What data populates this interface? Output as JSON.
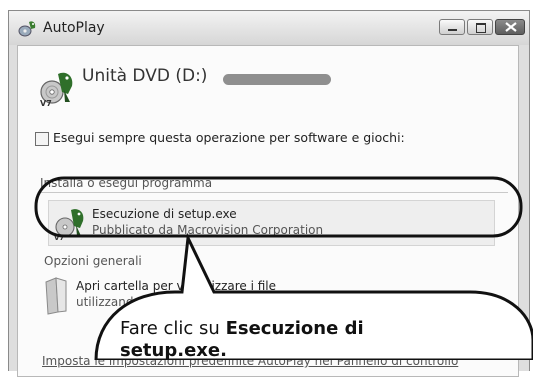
{
  "window": {
    "title": "AutoPlay"
  },
  "device": {
    "name": "Unità DVD (D:)"
  },
  "always_option": {
    "label": "Esegui sempre questa operazione per software e giochi:"
  },
  "section_install": {
    "heading": "Installa o esegui programma"
  },
  "run_option": {
    "title": "Esecuzione di setup.exe",
    "subtitle": "Pubblicato da Macrovision Corporation"
  },
  "section_general": {
    "heading": "Opzioni generali"
  },
  "folder_option": {
    "title": "Apri cartella per visualizzare i file",
    "subtitle": "utilizzando Esplora risorse"
  },
  "settings_link": {
    "text": "Imposta le impostazioni predefinite AutoPlay nel Pannello di controllo"
  },
  "callout": {
    "prefix": "Fare clic su ",
    "bold": "Esecuzione di setup.exe",
    "suffix": "."
  },
  "icons": {
    "title": "autoplay-icon",
    "device": "dvd-disc-parrot-icon",
    "run": "setup-parrot-icon",
    "folder": "folder-icon"
  }
}
